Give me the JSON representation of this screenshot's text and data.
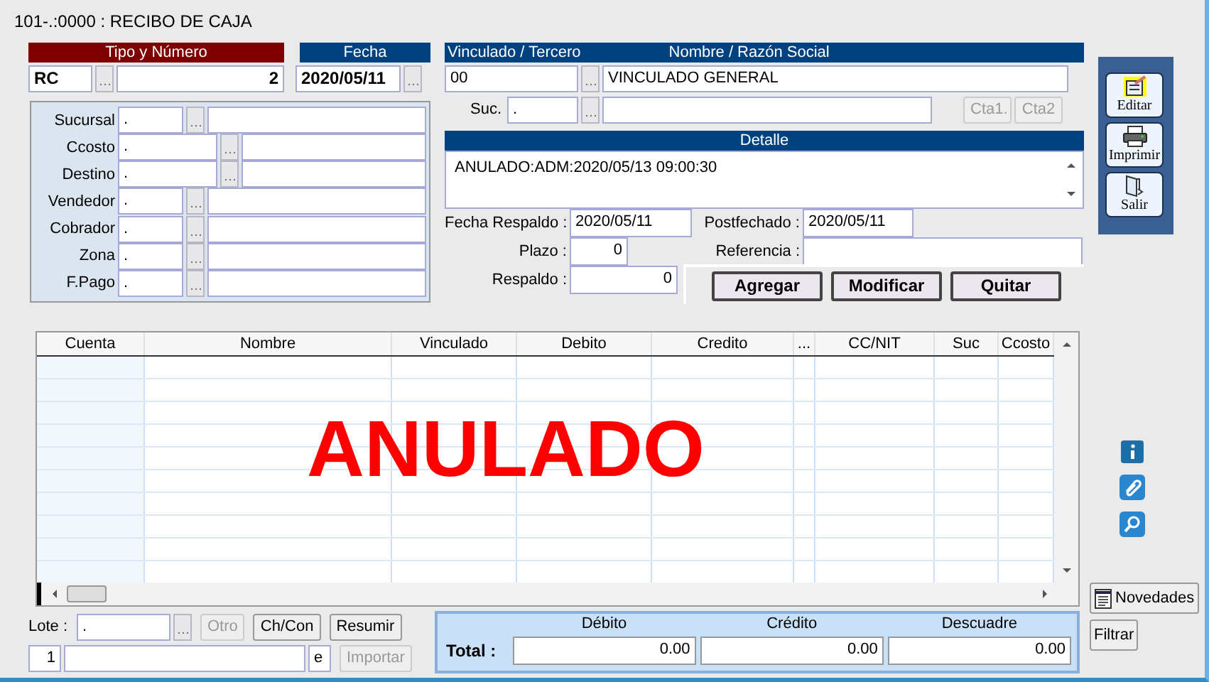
{
  "window": {
    "title": "101-.:0000 : RECIBO DE CAJA"
  },
  "document": {
    "type_header": "Tipo y Número",
    "type": "RC",
    "number": "2",
    "date_header": "Fecha",
    "date": "2020/05/11"
  },
  "filters": [
    {
      "label": "Sucursal",
      "code": ".",
      "kind": "narrow"
    },
    {
      "label": "Ccosto",
      "code": ".",
      "kind": "wide"
    },
    {
      "label": "Destino",
      "code": ".",
      "kind": "wide"
    },
    {
      "label": "Vendedor",
      "code": ".",
      "kind": "narrow"
    },
    {
      "label": "Cobrador",
      "code": ".",
      "kind": "narrow"
    },
    {
      "label": "Zona",
      "code": ".",
      "kind": "narrow"
    },
    {
      "label": "F.Pago",
      "code": ".",
      "kind": "narrow"
    }
  ],
  "third_party": {
    "code_header": "Vinculado / Tercero",
    "name_header": "Nombre / Razón Social",
    "code": "00",
    "name": "VINCULADO GENERAL",
    "branch_label": "Suc.",
    "branch_code": ".",
    "account_buttons": [
      {
        "label": "Cta1.",
        "disabled": true
      },
      {
        "label": "Cta2",
        "disabled": true
      }
    ]
  },
  "detail": {
    "header": "Detalle",
    "text": "ANULADO:ADM:2020/05/13 09:00:30"
  },
  "backup": {
    "date_label": "Fecha Respaldo :",
    "date": "2020/05/11",
    "postdated_label": "Postfechado :",
    "postdated": "2020/05/11",
    "term_label": "Plazo :",
    "term": "0",
    "reference_label": "Referencia :",
    "backup_label": "Respaldo :",
    "backup": "0"
  },
  "line_actions": [
    "Agregar",
    "Modificar",
    "Quitar"
  ],
  "table": {
    "columns": [
      "Cuenta",
      "Nombre",
      "Vinculado",
      "Debito",
      "Credito",
      "...",
      "CC/NIT",
      "Suc",
      "Ccosto"
    ],
    "stamp": "ANULADO"
  },
  "lote": {
    "label": "Lote :",
    "code": ".",
    "number": "1",
    "suffix": "e"
  },
  "lote_buttons": [
    {
      "label": "Otro",
      "disabled": true
    },
    {
      "label": "Ch/Con",
      "disabled": false
    },
    {
      "label": "Resumir",
      "disabled": false
    },
    {
      "label": "Importar",
      "disabled": true
    }
  ],
  "totals": {
    "label": "Total :",
    "columns": [
      {
        "header": "Débito",
        "value": "0.00"
      },
      {
        "header": "Crédito",
        "value": "0.00"
      },
      {
        "header": "Descuadre",
        "value": "0.00"
      }
    ]
  },
  "toolbar": [
    {
      "label": "Editar",
      "kind": "edit"
    },
    {
      "label": "Imprimir",
      "kind": "print"
    },
    {
      "label": "Salir",
      "kind": "exit"
    }
  ],
  "side_icons": [
    {
      "kind": "info"
    },
    {
      "kind": "attach"
    },
    {
      "kind": "search"
    }
  ],
  "side_buttons": [
    {
      "label": "Novedades",
      "kind": "document"
    },
    {
      "label": "Filtrar",
      "kind": "plain"
    }
  ]
}
